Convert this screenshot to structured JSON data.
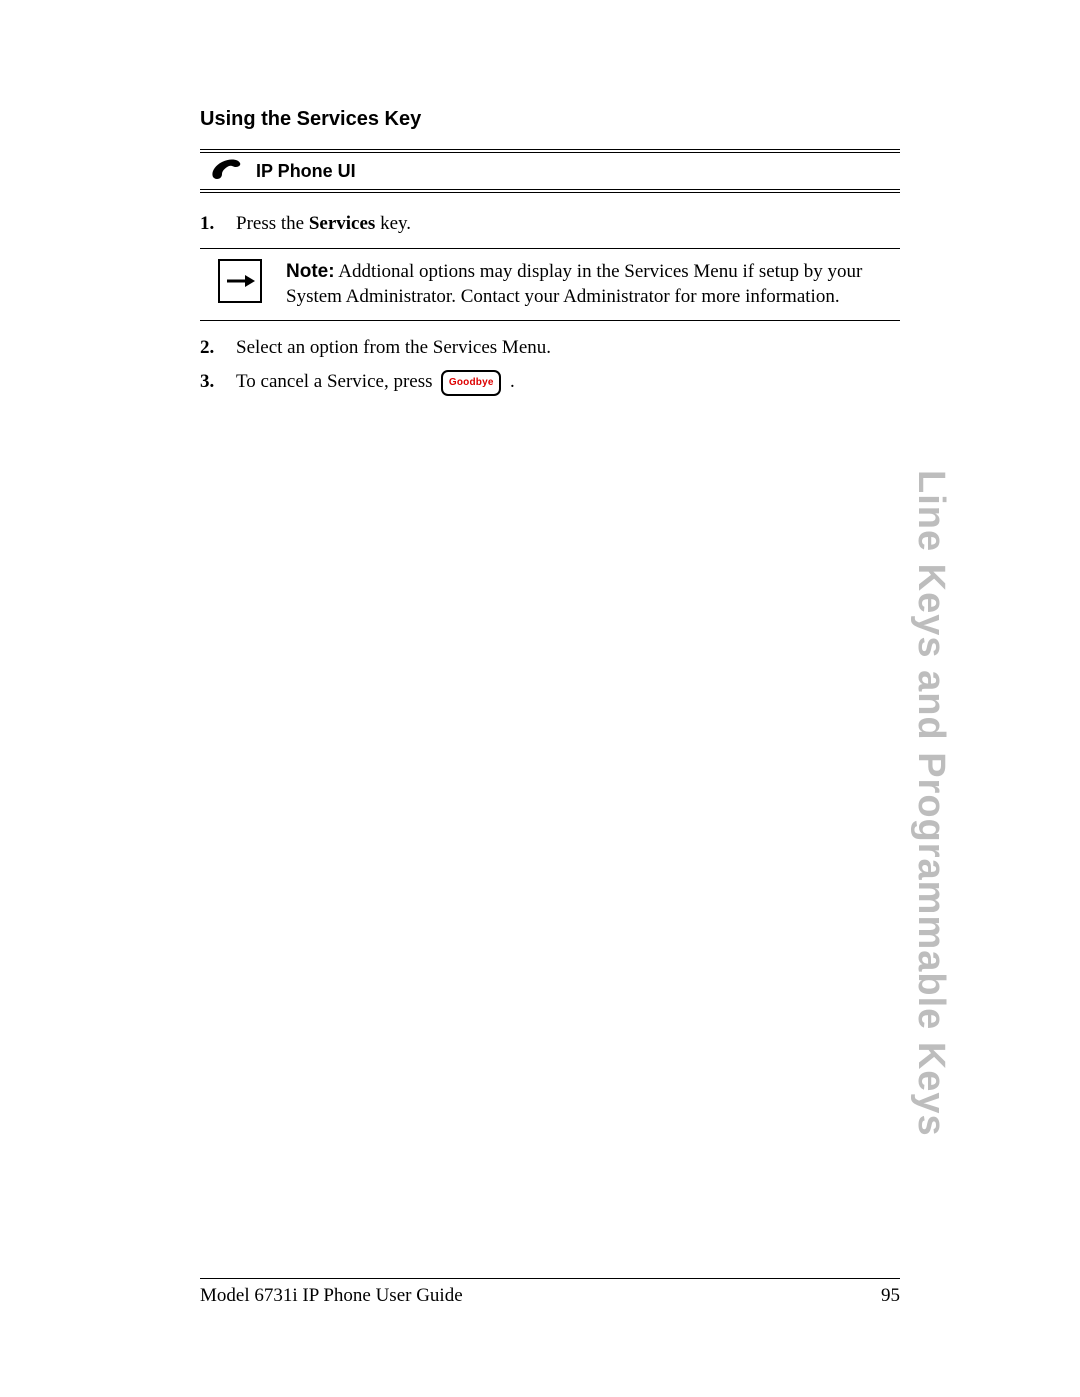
{
  "heading": "Using the Services Key",
  "banner": {
    "label": "IP Phone UI"
  },
  "steps": {
    "s1": {
      "num": "1.",
      "pre": "Press the ",
      "bold": "Services",
      "post": " key."
    },
    "s2": {
      "num": "2.",
      "text": "Select an option from the Services Menu."
    },
    "s3": {
      "num": "3.",
      "pre": "To cancel a Service, press ",
      "post": "."
    }
  },
  "note": {
    "lead": "Note:",
    "body": " Addtional options may display in the Services Menu if setup by your System Administrator. Contact your Administrator for more information."
  },
  "goodbye_label": "Goodbye",
  "side_tab": "Line Keys and Programmable Keys",
  "footer": {
    "title": "Model 6731i IP Phone User Guide",
    "page": "95"
  }
}
